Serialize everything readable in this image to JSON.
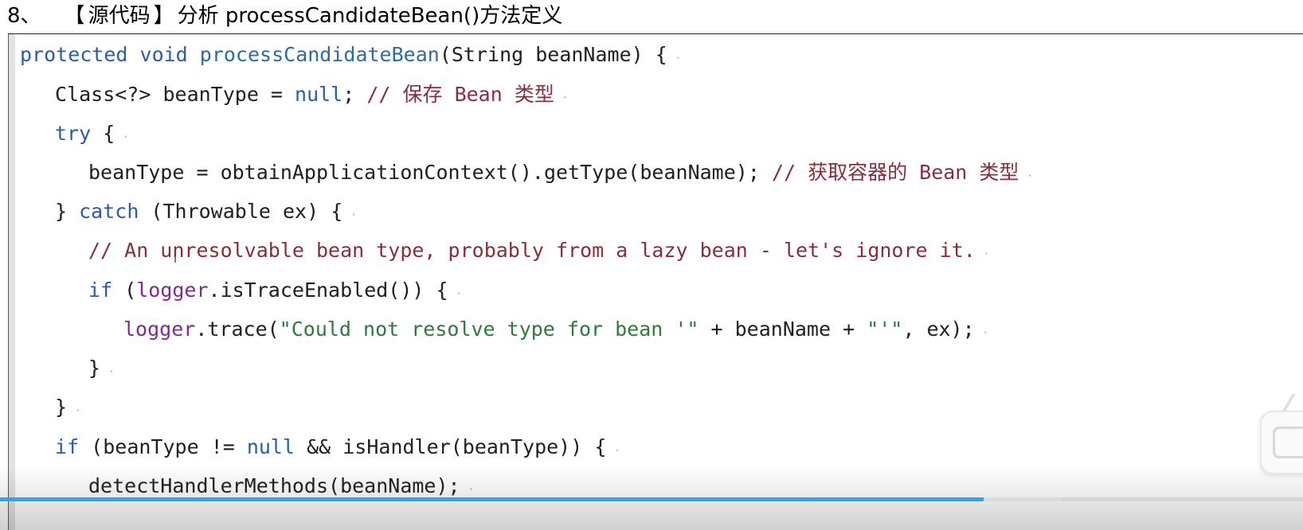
{
  "heading": {
    "number": "8、",
    "bracket_open": "【",
    "bracket_label": "源代码",
    "bracket_close": "】",
    "text": "分析 processCandidateBean()方法定义"
  },
  "code_lines": [
    {
      "indent": 0,
      "tokens": [
        {
          "t": "protected void ",
          "c": "kw"
        },
        {
          "t": "processCandidateBean",
          "c": "meth"
        },
        {
          "t": "(String beanName) {",
          "c": "plain"
        }
      ]
    },
    {
      "indent": 1,
      "tokens": [
        {
          "t": "Class<?> beanType = ",
          "c": "plain"
        },
        {
          "t": "null",
          "c": "kw"
        },
        {
          "t": "; ",
          "c": "plain"
        },
        {
          "t": "// 保存 Bean 类型",
          "c": "com"
        }
      ]
    },
    {
      "indent": 1,
      "tokens": [
        {
          "t": "try",
          "c": "kw"
        },
        {
          "t": " {",
          "c": "plain"
        }
      ]
    },
    {
      "indent": 2,
      "tokens": [
        {
          "t": "beanType = obtainApplicationContext().getType(beanName); ",
          "c": "plain"
        },
        {
          "t": "// 获取容器的 Bean 类型",
          "c": "com"
        }
      ]
    },
    {
      "indent": 1,
      "tokens": [
        {
          "t": "} ",
          "c": "plain"
        },
        {
          "t": "catch",
          "c": "kw"
        },
        {
          "t": " (Throwable ex) {",
          "c": "plain"
        }
      ]
    },
    {
      "indent": 2,
      "tokens": [
        {
          "t": "// An unresolvable bean type, probably from a lazy bean - let's ignore it.",
          "c": "com"
        }
      ]
    },
    {
      "indent": 2,
      "tokens": [
        {
          "t": "if",
          "c": "kw"
        },
        {
          "t": " (",
          "c": "plain"
        },
        {
          "t": "logger",
          "c": "field"
        },
        {
          "t": ".isTraceEnabled()) {",
          "c": "plain"
        }
      ]
    },
    {
      "indent": 3,
      "tokens": [
        {
          "t": "logger",
          "c": "field"
        },
        {
          "t": ".trace(",
          "c": "plain"
        },
        {
          "t": "\"Could not resolve type for bean '\"",
          "c": "str"
        },
        {
          "t": " + beanName + ",
          "c": "plain"
        },
        {
          "t": "\"'\"",
          "c": "str"
        },
        {
          "t": ", ex);",
          "c": "plain"
        }
      ]
    },
    {
      "indent": 2,
      "tokens": [
        {
          "t": "}",
          "c": "plain"
        }
      ]
    },
    {
      "indent": 1,
      "tokens": [
        {
          "t": "}",
          "c": "plain"
        }
      ]
    },
    {
      "indent": 1,
      "tokens": [
        {
          "t": "if",
          "c": "kw"
        },
        {
          "t": " (beanType != ",
          "c": "plain"
        },
        {
          "t": "null",
          "c": "kw"
        },
        {
          "t": " && isHandler(beanType)) {",
          "c": "plain"
        }
      ]
    },
    {
      "indent": 2,
      "tokens": [
        {
          "t": "detectHandlerMethods(beanName);",
          "c": "plain"
        }
      ]
    }
  ],
  "player": {
    "progress_fraction": 0.755,
    "buffered_fraction": 0.815,
    "progress_color": "#2fa4e7",
    "float_button_icon": "tv-icon"
  },
  "colors": {
    "keyword": "#2a5ca8",
    "method": "#2e6b9e",
    "comment": "#8a2d3a",
    "string": "#2e7a3c",
    "field": "#7a2d8c",
    "plain": "#202020"
  }
}
